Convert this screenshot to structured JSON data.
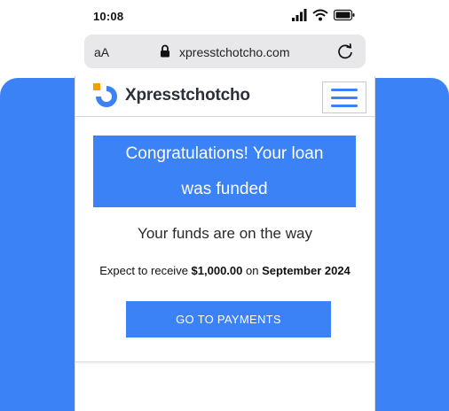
{
  "status_bar": {
    "time": "10:08"
  },
  "browser": {
    "text_size_label": "aA",
    "url": "xpresstchotcho.com"
  },
  "header": {
    "brand": "Xpresstchotcho"
  },
  "main": {
    "headline_line1": "Congratulations! Your loan",
    "headline_line2": "was funded",
    "subtitle": "Your funds are on the way",
    "expect_prefix": "Expect to receive ",
    "amount": "$1,000.00",
    "expect_mid": " on ",
    "date": "September 2024",
    "cta_label": "GO TO PAYMENTS"
  },
  "colors": {
    "accent": "#3b82f6",
    "logo_orange": "#f59e0b"
  },
  "icons": [
    "signal-icon",
    "wifi-icon",
    "battery-icon",
    "lock-icon",
    "reload-icon",
    "logo-icon",
    "hamburger-menu-icon"
  ]
}
